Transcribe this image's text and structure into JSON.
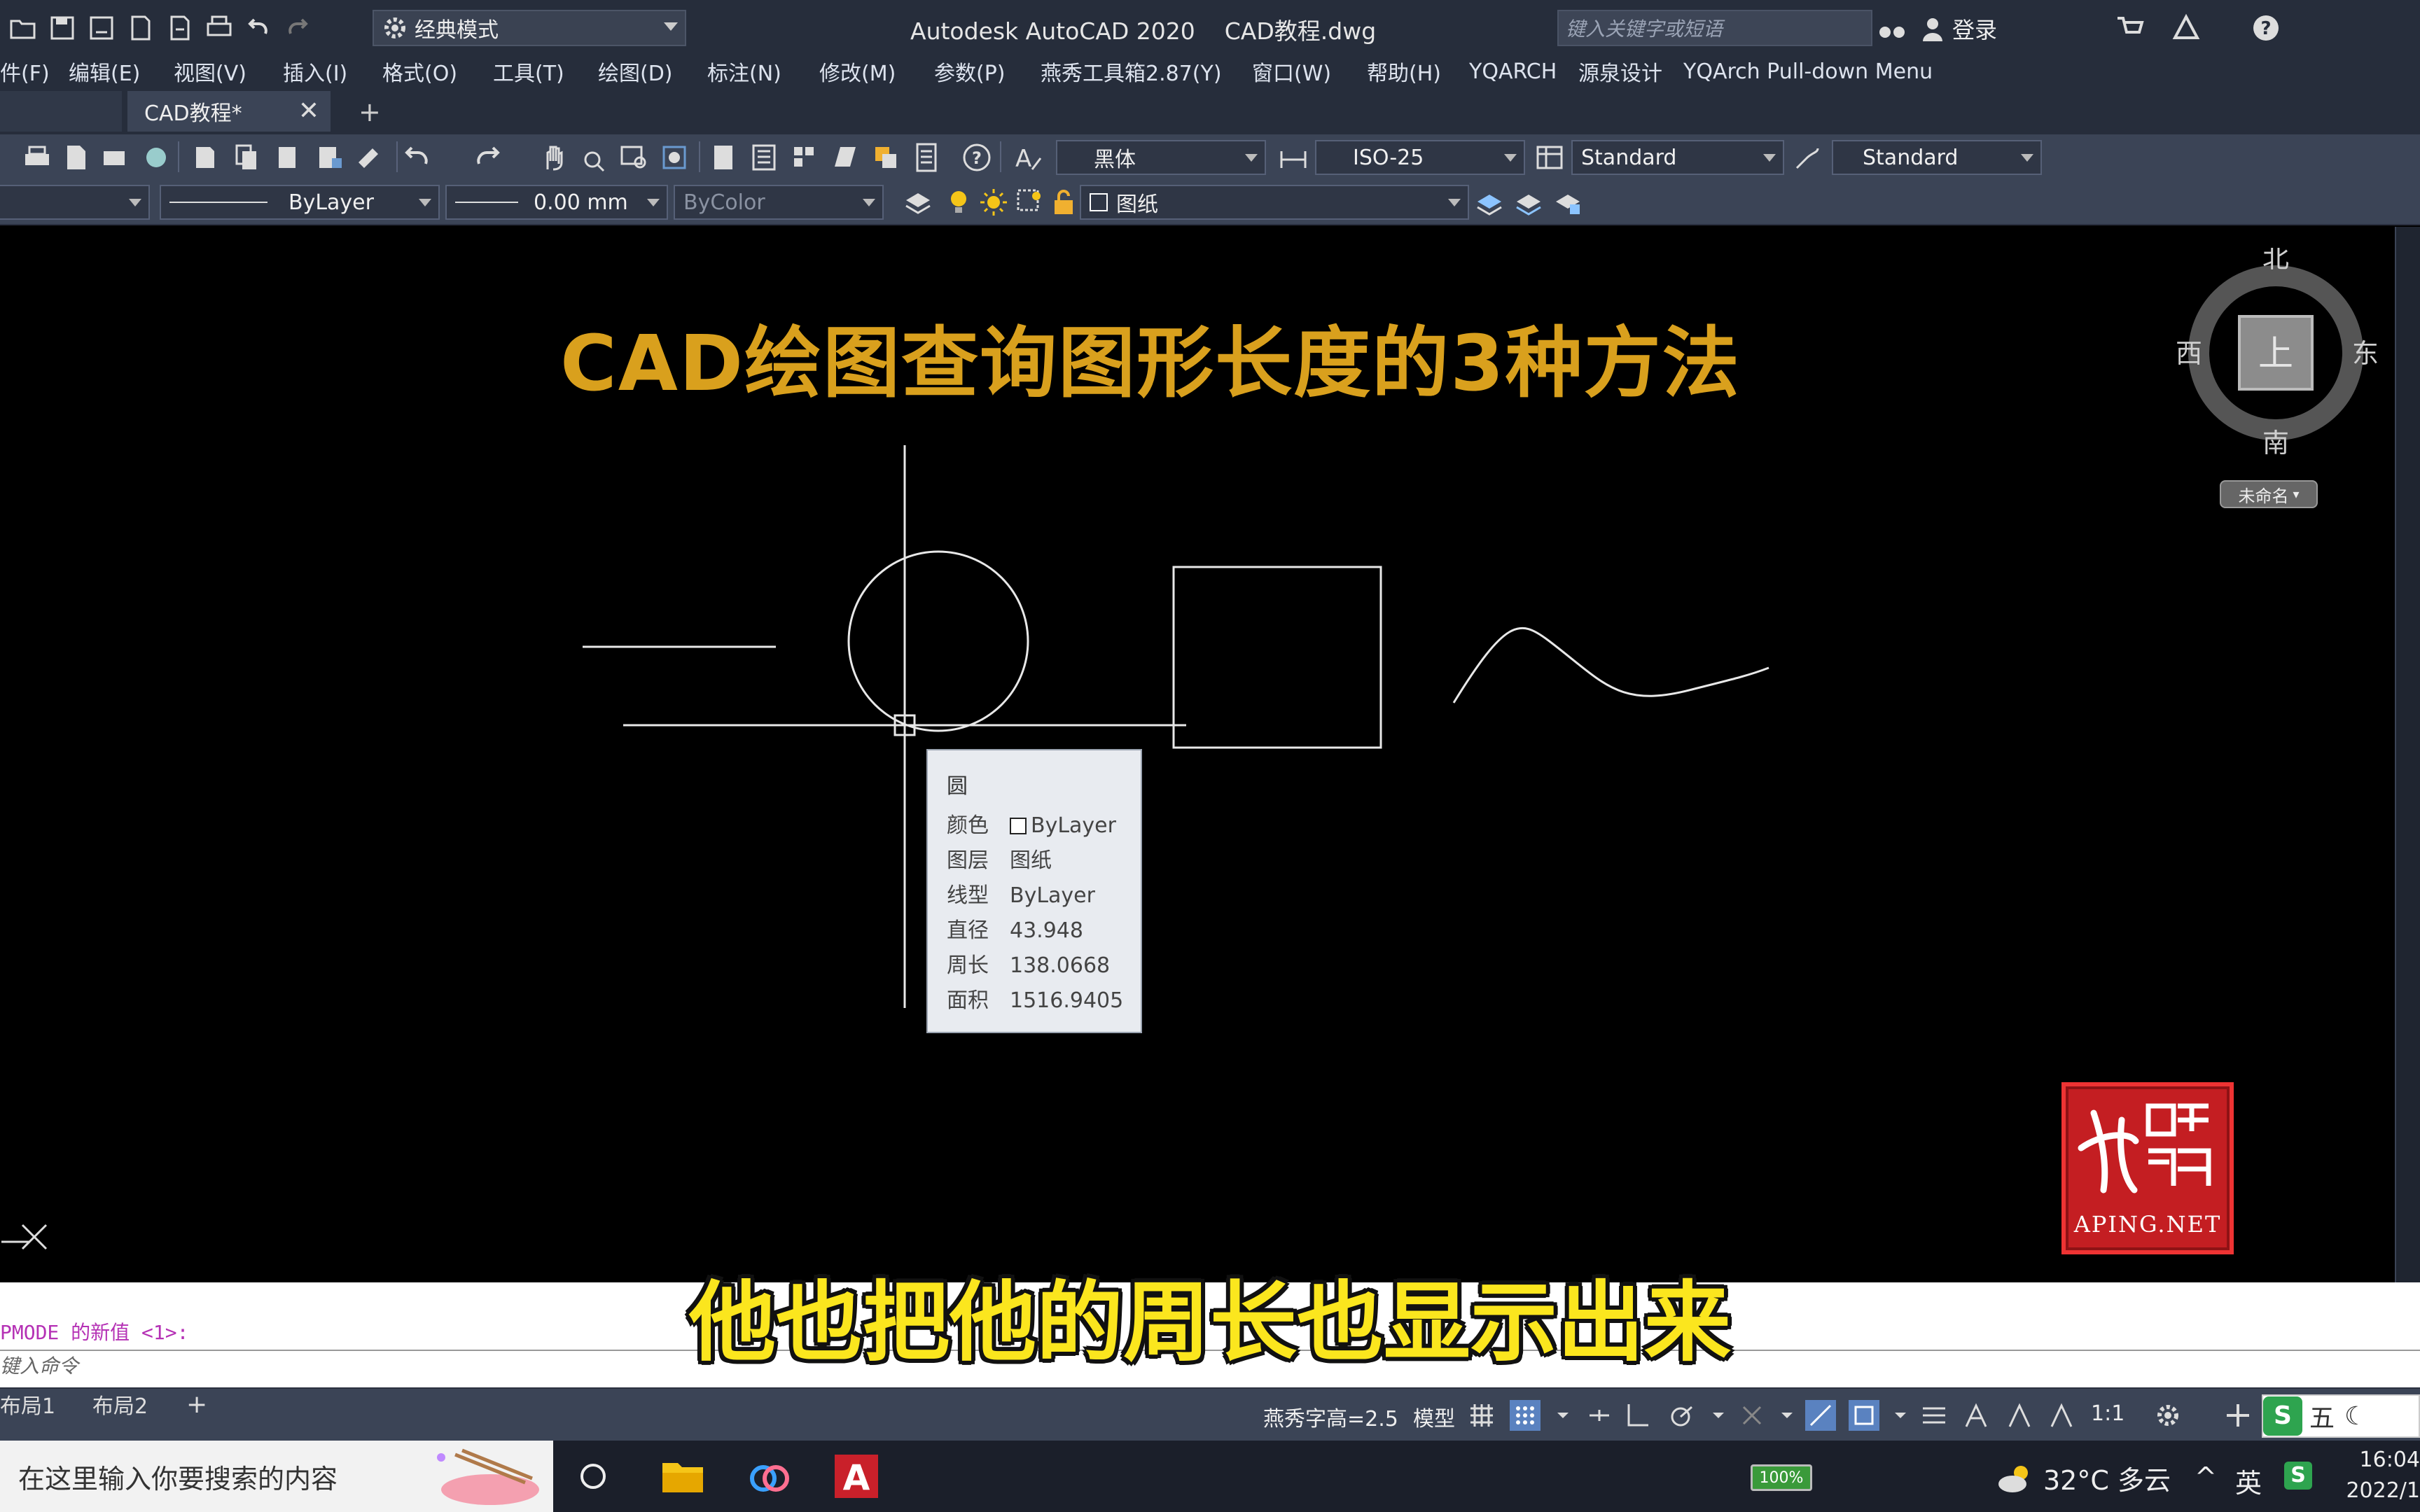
{
  "titlebar": {
    "workspace": "经典模式",
    "app_name": "Autodesk AutoCAD 2020",
    "document": "CAD教程.dwg",
    "search_placeholder": "键入关键字或短语",
    "login": "登录"
  },
  "menubar": {
    "items": [
      "件(F)",
      "编辑(E)",
      "视图(V)",
      "插入(I)",
      "格式(O)",
      "工具(T)",
      "绘图(D)",
      "标注(N)",
      "修改(M)",
      "参数(P)",
      "燕秀工具箱2.87(Y)",
      "窗口(W)",
      "帮助(H)",
      "YQARCH",
      "源泉设计",
      "YQArch Pull-down Menu"
    ]
  },
  "tabs": {
    "active": "CAD教程*",
    "new_tab": "+"
  },
  "toolbar1": {
    "text_font": "黑体",
    "dim_style": "ISO-25",
    "table_style": "Standard",
    "multileader_style": "Standard"
  },
  "toolbar2": {
    "linetype": "ByLayer",
    "lineweight": "0.00 mm",
    "plot_style": "ByColor",
    "layer": "图纸"
  },
  "drawing": {
    "title": "CAD绘图查询图形长度的3种方法"
  },
  "viewcube": {
    "north": "北",
    "south": "南",
    "east": "东",
    "west": "西",
    "top": "上",
    "wcs": "未命名"
  },
  "tooltip": {
    "title": "圆",
    "rows": [
      {
        "key": "颜色",
        "value": "ByLayer"
      },
      {
        "key": "图层",
        "value": "图纸"
      },
      {
        "key": "线型",
        "value": "ByLayer"
      },
      {
        "key": "直径",
        "value": "43.948"
      },
      {
        "key": "周长",
        "value": "138.0668"
      },
      {
        "key": "面积",
        "value": "1516.9405"
      }
    ]
  },
  "seal": {
    "text": "APING.NET"
  },
  "cmdline": {
    "history": "PMODE 的新值 <1>:",
    "prompt": "键入命令"
  },
  "subtitle": "他也把他的周长也显示出来",
  "statusbar": {
    "layout_tabs": [
      "布局1",
      "布局2"
    ],
    "add_layout": "+",
    "font_height": "燕秀字高=2.5",
    "model": "模型",
    "scale": "1:1",
    "ime": "五"
  },
  "taskbar": {
    "search": "在这里输入你要搜索的内容",
    "battery": "100%",
    "weather": "32°C 多云",
    "tray_chevron": "^",
    "lang": "英",
    "time": "16:04",
    "date": "2022/1"
  },
  "colors": {
    "chrome_dark": "#262d3b",
    "chrome_mid": "#3b4456",
    "title_gold": "#d9a01d",
    "subtitle_yellow": "#fbe61e",
    "seal_red": "#c41e22"
  }
}
